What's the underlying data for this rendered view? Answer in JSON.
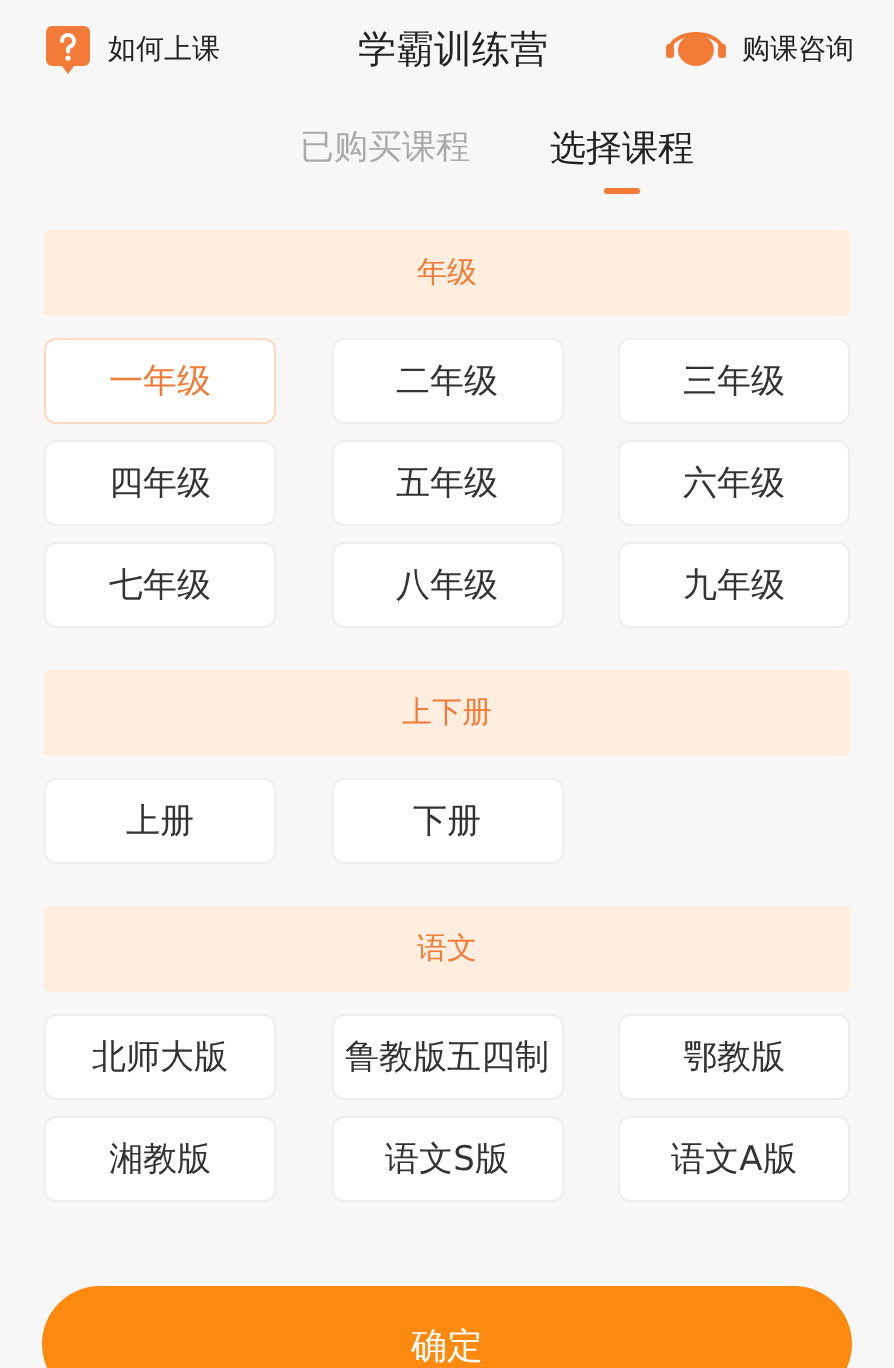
{
  "header": {
    "help_label": "如何上课",
    "title": "学霸训练营",
    "consult_label": "购课咨询"
  },
  "tabs": [
    {
      "label": "已购买课程",
      "selected": false
    },
    {
      "label": "选择课程",
      "selected": true
    }
  ],
  "sections": [
    {
      "title": "年级",
      "options": [
        {
          "label": "一年级",
          "selected": true
        },
        {
          "label": "二年级",
          "selected": false
        },
        {
          "label": "三年级",
          "selected": false
        },
        {
          "label": "四年级",
          "selected": false
        },
        {
          "label": "五年级",
          "selected": false
        },
        {
          "label": "六年级",
          "selected": false
        },
        {
          "label": "七年级",
          "selected": false
        },
        {
          "label": "八年级",
          "selected": false
        },
        {
          "label": "九年级",
          "selected": false
        }
      ]
    },
    {
      "title": "上下册",
      "options": [
        {
          "label": "上册",
          "selected": false
        },
        {
          "label": "下册",
          "selected": false
        }
      ]
    },
    {
      "title": "语文",
      "options": [
        {
          "label": "北师大版",
          "selected": false
        },
        {
          "label": "鲁教版五四制",
          "selected": false
        },
        {
          "label": "鄂教版",
          "selected": false
        },
        {
          "label": "湘教版",
          "selected": false
        },
        {
          "label": "语文S版",
          "selected": false
        },
        {
          "label": "语文A版",
          "selected": false
        }
      ]
    }
  ],
  "confirm_button": "确定"
}
